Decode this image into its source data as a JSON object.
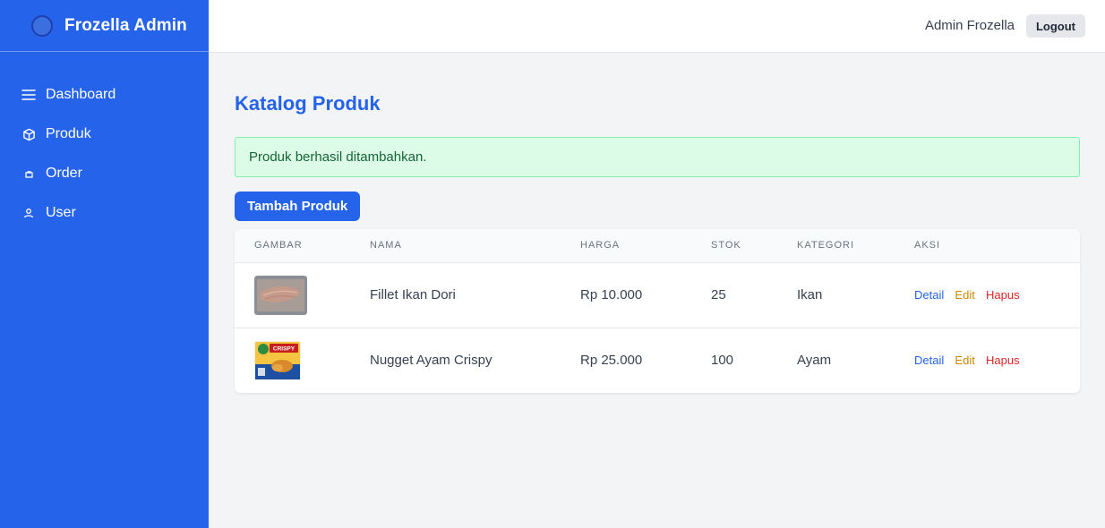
{
  "brand": {
    "name": "Frozella Admin"
  },
  "nav": {
    "items": [
      {
        "label": "Dashboard",
        "icon": "menu-icon"
      },
      {
        "label": "Produk",
        "icon": "box-icon"
      },
      {
        "label": "Order",
        "icon": "bag-icon"
      },
      {
        "label": "User",
        "icon": "user-icon"
      }
    ]
  },
  "header": {
    "user_name": "Admin Frozella",
    "logout_label": "Logout"
  },
  "page": {
    "title": "Katalog Produk",
    "alert": "Produk berhasil ditambahkan.",
    "add_button": "Tambah Produk"
  },
  "table": {
    "columns": [
      "GAMBAR",
      "NAMA",
      "HARGA",
      "STOK",
      "KATEGORI",
      "AKSI"
    ],
    "rows": [
      {
        "name": "Fillet Ikan Dori",
        "price": "Rp 10.000",
        "stock": "25",
        "category": "Ikan",
        "image": "fish-fillet-image"
      },
      {
        "name": "Nugget Ayam Crispy",
        "price": "Rp 25.000",
        "stock": "100",
        "category": "Ayam",
        "image": "nugget-package-image",
        "image_text": "CRISPY"
      }
    ],
    "actions": {
      "detail": "Detail",
      "edit": "Edit",
      "delete": "Hapus"
    }
  },
  "colors": {
    "sidebar": "#2563eb",
    "accent": "#2563eb",
    "success_bg": "#dcfce7",
    "success_text": "#166534",
    "edit": "#ca8a04",
    "delete": "#dc2626"
  }
}
